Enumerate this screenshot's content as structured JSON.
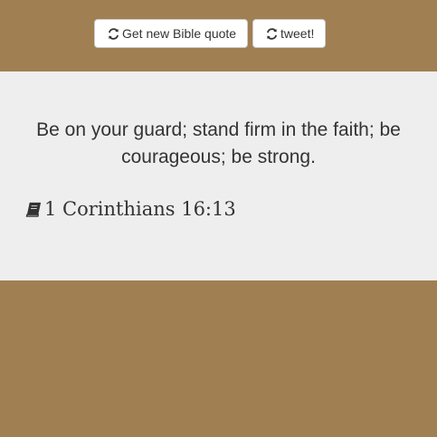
{
  "toolbar": {
    "new_quote_label": "Get new Bible quote",
    "new_quote_icon": "refresh-icon",
    "tweet_label": "tweet!",
    "tweet_icon": "refresh-icon"
  },
  "quote": {
    "text": "Be on your guard; stand firm in the faith; be courageous; be strong.",
    "source": "1 Corinthians 16:13",
    "source_icon": "book-icon"
  },
  "colors": {
    "background": "#a07f52",
    "panel": "#eeeeee",
    "text": "#333333",
    "button_bg": "#ffffff",
    "button_border": "#cccccc"
  }
}
